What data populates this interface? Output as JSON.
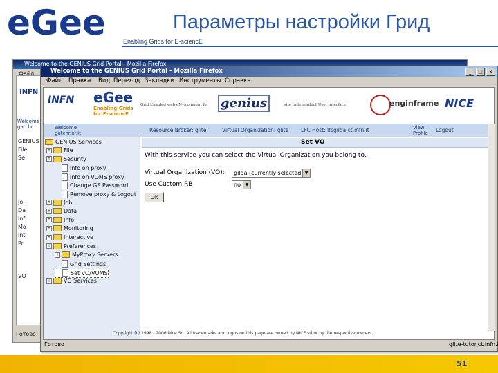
{
  "slide": {
    "title": "Параметры настройки Грид",
    "tagline": "Enabling Grids for E-sciencE",
    "logo_text": "eGee",
    "page_number": "51",
    "colors": {
      "title": "#2a55a3",
      "bar": "#f0b400",
      "logo": "#1a3b8c"
    }
  },
  "back_window": {
    "title": "Welcome to the GENIUS Grid Portal - Mozilla Firefox",
    "menu_first": "Файл",
    "banner_org": "INFN",
    "nav_partial": "Welcome gatchr",
    "tree": [
      "GENIUS",
      "File",
      "Se",
      "Jol",
      "Da",
      "Inf",
      "Mo",
      "Int",
      "Pr",
      "VO"
    ],
    "status": "Готово"
  },
  "window": {
    "title": "Welcome to the GENIUS Grid Portal - Mozilla Firefox",
    "buttons": {
      "minimize": "_",
      "maximize": "□",
      "close": "×"
    },
    "menu": [
      "Файл",
      "Правка",
      "Вид",
      "Переход",
      "Закладки",
      "Инструменты",
      "Справка"
    ]
  },
  "banner": {
    "infn": "INFN",
    "egee_logo": "eGee",
    "egee_tagline": "Enabling Grids for E-sciencE",
    "genius_prefix": "Grid Enabled web eNvironment for",
    "genius_logo": "genius",
    "genius_suffix": "site Independent User interface",
    "enginframe": "enginframe",
    "nice": "NICE"
  },
  "nav": {
    "welcome": "Welcome gatchr.nr.it",
    "items": [
      "Resource Broker: glite",
      "Virtual Organization: glite",
      "LFC Host: lfcgilda.ct.infn.it",
      "View Profile"
    ],
    "logout": "Logout"
  },
  "sidebar": {
    "root": "GENIUS Services",
    "items": [
      {
        "label": "File",
        "indent": 0,
        "type": "folder"
      },
      {
        "label": "Security",
        "indent": 0,
        "type": "folder"
      },
      {
        "label": "Info on proxy",
        "indent": 1,
        "type": "doc"
      },
      {
        "label": "Info on VOMS proxy",
        "indent": 1,
        "type": "doc"
      },
      {
        "label": "Change GS Password",
        "indent": 1,
        "type": "doc"
      },
      {
        "label": "Remove proxy & Logout",
        "indent": 1,
        "type": "doc"
      },
      {
        "label": "Job",
        "indent": 0,
        "type": "folder"
      },
      {
        "label": "Data",
        "indent": 0,
        "type": "folder"
      },
      {
        "label": "Info",
        "indent": 0,
        "type": "folder"
      },
      {
        "label": "Monitoring",
        "indent": 0,
        "type": "folder"
      },
      {
        "label": "Interactive",
        "indent": 0,
        "type": "folder"
      },
      {
        "label": "Preferences",
        "indent": 0,
        "type": "folder"
      },
      {
        "label": "MyProxy Servers",
        "indent": 1,
        "type": "folder"
      },
      {
        "label": "Grid Settings",
        "indent": 1,
        "type": "doc"
      },
      {
        "label": "Set VO/VOMS",
        "indent": 1,
        "type": "doc",
        "selected": true
      },
      {
        "label": "VO Services",
        "indent": 0,
        "type": "folder"
      }
    ]
  },
  "panel": {
    "title": "Set VO",
    "description": "With this service you can select the Virtual Organization you belong to.",
    "vo_label": "Virtual Organization (VO):",
    "vo_value": "gilda (currently selected)",
    "custom_label": "Use Custom RB",
    "custom_value": "no",
    "ok_button": "Ok"
  },
  "footer": {
    "copyright": "Copyright (c) 1998 - 2006 Nice Srl. All trademarks and logos on this page are owned by NICE srl or by the respective owners."
  },
  "status": {
    "left": "Готово",
    "right": "glite-tutor.ct.infn.it"
  }
}
